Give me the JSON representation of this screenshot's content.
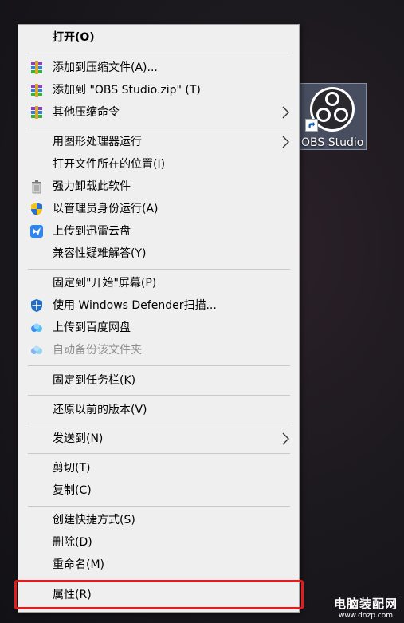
{
  "desktop": {
    "icon_label": "OBS Studio"
  },
  "menu": {
    "items": [
      {
        "label": "打开(O)"
      },
      {
        "label": "添加到压缩文件(A)..."
      },
      {
        "label": "添加到 \"OBS Studio.zip\" (T)"
      },
      {
        "label": "其他压缩命令"
      },
      {
        "label": "用图形处理器运行"
      },
      {
        "label": "打开文件所在的位置(I)"
      },
      {
        "label": "强力卸载此软件"
      },
      {
        "label": "以管理员身份运行(A)"
      },
      {
        "label": "上传到迅雷云盘"
      },
      {
        "label": "兼容性疑难解答(Y)"
      },
      {
        "label": "固定到\"开始\"屏幕(P)"
      },
      {
        "label": "使用 Windows Defender扫描..."
      },
      {
        "label": "上传到百度网盘"
      },
      {
        "label": "自动备份该文件夹"
      },
      {
        "label": "固定到任务栏(K)"
      },
      {
        "label": "还原以前的版本(V)"
      },
      {
        "label": "发送到(N)"
      },
      {
        "label": "剪切(T)"
      },
      {
        "label": "复制(C)"
      },
      {
        "label": "创建快捷方式(S)"
      },
      {
        "label": "删除(D)"
      },
      {
        "label": "重命名(M)"
      },
      {
        "label": "属性(R)"
      }
    ]
  },
  "watermark": {
    "line1": "电脑装配网",
    "line2": "www.dnzp.com"
  },
  "colors": {
    "highlight": "#e31d1d",
    "menu_bg": "#efefef"
  }
}
